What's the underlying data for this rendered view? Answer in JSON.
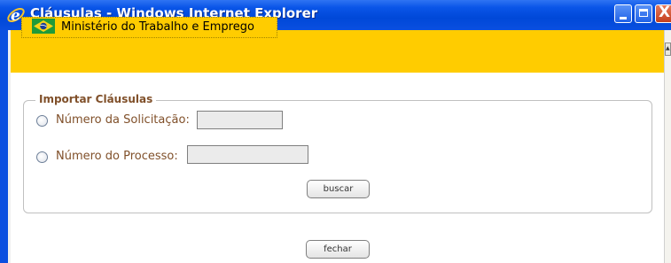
{
  "window": {
    "title": "Cláusulas - Windows Internet Explorer",
    "controls": {
      "minimize": "minimize",
      "maximize": "maximize",
      "close": "X"
    }
  },
  "header": {
    "ministry_label": "Ministério do Trabalho e Emprego"
  },
  "form": {
    "legend": "Importar Cláusulas",
    "options": [
      {
        "label": "Número da Solicitação:",
        "value": "",
        "selected": false
      },
      {
        "label": "Número do Processo:",
        "value": "",
        "selected": false
      }
    ],
    "search_button": "buscar"
  },
  "footer": {
    "close_button": "fechar"
  },
  "colors": {
    "title_bar": "#0a55e8",
    "header_strip": "#ffcc00",
    "label_text": "#80502a",
    "input_bg": "#ebebeb"
  },
  "icons": [
    "ie-logo-icon",
    "brazil-flag-icon",
    "minimize-icon",
    "maximize-icon",
    "close-icon",
    "scroll-up-icon"
  ]
}
